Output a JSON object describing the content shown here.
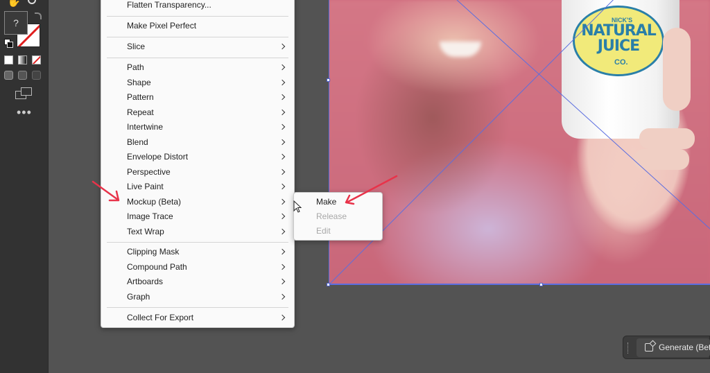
{
  "toolbar": {
    "fill_placeholder": "?",
    "more_label": "•••",
    "icons": [
      "hand-icon",
      "zoom-icon",
      "swap-fill-stroke-icon",
      "default-colors-icon",
      "color-mode-icon",
      "gradient-mode-icon",
      "none-mode-icon",
      "draw-normal-icon",
      "draw-behind-icon",
      "draw-inside-icon",
      "screen-mode-icon",
      "more-tools-icon"
    ]
  },
  "artwork": {
    "label_top": "NICK'S",
    "label_line1": "NATURAL",
    "label_line2": "JUICE",
    "label_bottom": "CO."
  },
  "context_menu": {
    "items": [
      {
        "label": "Flatten Transparency...",
        "submenu": false
      },
      {
        "label": "Make Pixel Perfect",
        "submenu": false
      },
      {
        "label": "Slice",
        "submenu": true
      },
      {
        "label": "Path",
        "submenu": true
      },
      {
        "label": "Shape",
        "submenu": true
      },
      {
        "label": "Pattern",
        "submenu": true
      },
      {
        "label": "Repeat",
        "submenu": true
      },
      {
        "label": "Intertwine",
        "submenu": true
      },
      {
        "label": "Blend",
        "submenu": true
      },
      {
        "label": "Envelope Distort",
        "submenu": true
      },
      {
        "label": "Perspective",
        "submenu": true
      },
      {
        "label": "Live Paint",
        "submenu": true
      },
      {
        "label": "Mockup (Beta)",
        "submenu": true
      },
      {
        "label": "Image Trace",
        "submenu": true
      },
      {
        "label": "Text Wrap",
        "submenu": true
      },
      {
        "label": "Clipping Mask",
        "submenu": true
      },
      {
        "label": "Compound Path",
        "submenu": true
      },
      {
        "label": "Artboards",
        "submenu": true
      },
      {
        "label": "Graph",
        "submenu": true
      },
      {
        "label": "Collect For Export",
        "submenu": true
      }
    ]
  },
  "submenu": {
    "items": [
      {
        "label": "Make",
        "enabled": true
      },
      {
        "label": "Release",
        "enabled": false
      },
      {
        "label": "Edit",
        "enabled": false
      }
    ]
  },
  "generate": {
    "label": "Generate (Beta)"
  },
  "colors": {
    "annotation_arrow": "#e8334a",
    "guide_line": "#5b6ee0",
    "menu_bg": "#fafafa",
    "workspace_bg": "#535353"
  }
}
